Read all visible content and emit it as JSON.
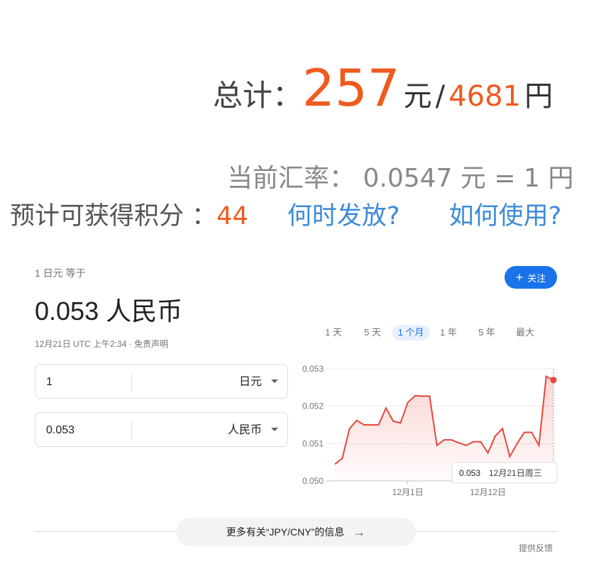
{
  "summary": {
    "total_label": "总计：",
    "total_yuan": "257",
    "yuan_unit": "元",
    "slash": "/",
    "total_yen": "4681",
    "yen_unit": "円",
    "rate_label": "当前汇率：",
    "rate_value": "0.0547",
    "rate_unit_yuan": "元",
    "rate_equals": "=",
    "rate_one": "1",
    "rate_unit_yen": "円",
    "points_label": "预计可获得积分",
    "points_colon": "：",
    "points_value": "44",
    "when_link": "何时发放?",
    "how_link": "如何使用?"
  },
  "widget": {
    "header": "1 日元 等于",
    "result": "0.053 人民币",
    "timestamp": "12月21日 UTC 上午2:34",
    "dot": " · ",
    "disclaimer": "免责声明",
    "follow_label": "关注",
    "from": {
      "amount": "1",
      "currency": "日元"
    },
    "to": {
      "amount": "0.053",
      "currency": "人民币"
    },
    "ranges": [
      "1 天",
      "5 天",
      "1 个月",
      "1 年",
      "5 年",
      "最大"
    ],
    "active_range": "1 个月",
    "more_info": "更多有关“JPY/CNY”的信息",
    "more_arrow": "→",
    "feedback": "提供反馈",
    "tooltip_value": "0.053",
    "tooltip_date": "12月21日周三"
  },
  "colors": {
    "accent": "#1a73e8",
    "line": "#e8453c",
    "orange": "#f05a1e"
  },
  "chart_data": {
    "type": "area",
    "ylim": [
      0.05,
      0.053
    ],
    "yticks": [
      "0.053",
      "0.052",
      "0.051",
      "0.050"
    ],
    "xticks": [
      "12月1日",
      "12月12日"
    ],
    "series": [
      {
        "values": [
          0.05045,
          0.0506,
          0.0514,
          0.05162,
          0.0515,
          0.0515,
          0.0515,
          0.05195,
          0.0516,
          0.05155,
          0.0521,
          0.05228,
          0.05227,
          0.05227,
          0.05095,
          0.0511,
          0.0511,
          0.05102,
          0.05095,
          0.05105,
          0.05105,
          0.05075,
          0.0512,
          0.0514,
          0.05065,
          0.051,
          0.0513,
          0.0513,
          0.05095,
          0.0528,
          0.0527
        ]
      }
    ]
  }
}
